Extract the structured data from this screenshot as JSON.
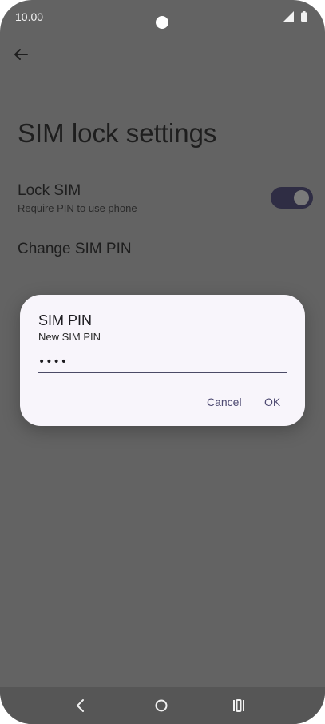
{
  "status_bar": {
    "time": "10.00",
    "icons": [
      "signal-icon",
      "battery-icon"
    ]
  },
  "header": {
    "back_icon": "back-arrow-icon"
  },
  "page": {
    "title": "SIM lock settings"
  },
  "prefs": {
    "lock_sim": {
      "title": "Lock SIM",
      "summary": "Require PIN to use phone",
      "enabled": true
    },
    "change_pin": {
      "title": "Change SIM PIN"
    }
  },
  "dialog": {
    "title": "SIM PIN",
    "subtitle": "New SIM PIN",
    "pin_value": "••••",
    "cancel_label": "Cancel",
    "ok_label": "OK"
  },
  "nav_bar": {
    "icons": [
      "nav-back-icon",
      "nav-home-icon",
      "nav-recents-icon"
    ]
  },
  "colors": {
    "background": "#636363",
    "dialog_bg": "#f8f5fb",
    "accent": "#4e4a72",
    "toggle_track": "#2f2d44"
  }
}
